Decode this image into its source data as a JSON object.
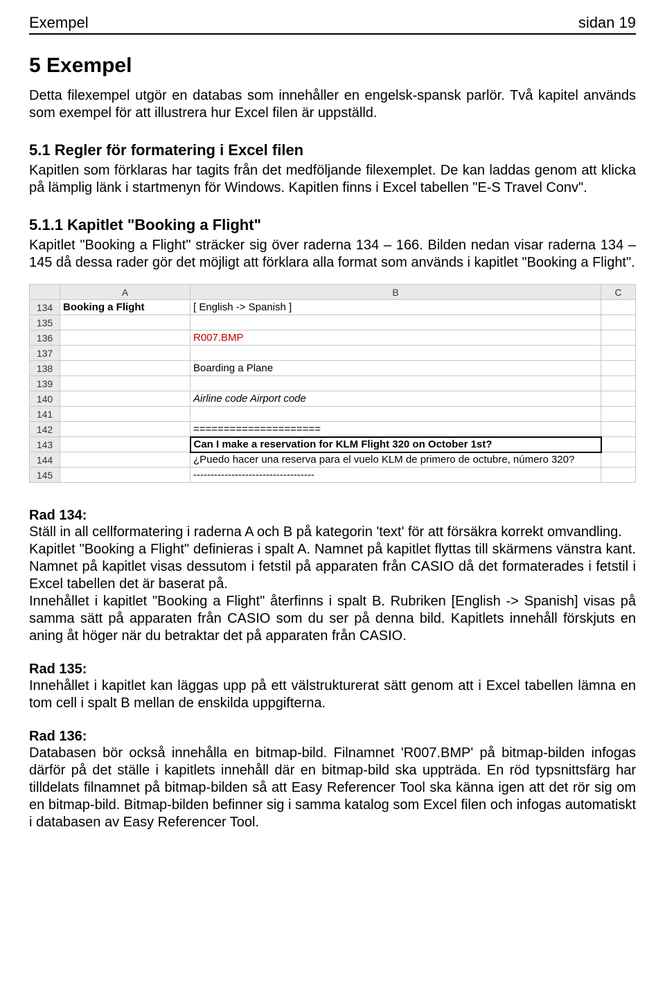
{
  "header": {
    "left": "Exempel",
    "right": "sidan 19"
  },
  "h1": "5  Exempel",
  "intro": "Detta filexempel utgör en databas som innehåller en engelsk-spansk parlör. Två kapitel används som exempel för att illustrera hur Excel filen är uppställd.",
  "h2": "5.1  Regler för formatering i Excel filen",
  "p2": "Kapitlen som förklaras har tagits från det medföljande filexemplet. De kan laddas genom att klicka på lämplig länk i startmenyn för Windows. Kapitlen finns i Excel tabellen \"E-S Travel Conv\".",
  "h3": "5.1.1 Kapitlet \"Booking a Flight\"",
  "p3": "Kapitlet \"Booking a Flight\" sträcker sig över raderna 134 – 166. Bilden nedan visar raderna 134 – 145 då dessa rader gör det möjligt att förklara alla format som används i kapitlet \"Booking a Flight\".",
  "excel": {
    "cols": [
      "",
      "A",
      "B",
      "C"
    ],
    "rows": [
      {
        "num": "134",
        "a": "Booking a Flight",
        "b": "[ English -> Spanish ]",
        "aBold": true
      },
      {
        "num": "135",
        "a": "",
        "b": ""
      },
      {
        "num": "136",
        "a": "",
        "b": "R007.BMP",
        "bRed": true
      },
      {
        "num": "137",
        "a": "",
        "b": ""
      },
      {
        "num": "138",
        "a": "",
        "b": "Boarding a Plane"
      },
      {
        "num": "139",
        "a": "",
        "b": ""
      },
      {
        "num": "140",
        "a": "",
        "b": "Airline code    Airport code",
        "bItalic": true
      },
      {
        "num": "141",
        "a": "",
        "b": ""
      },
      {
        "num": "142",
        "a": "",
        "b": "=====================",
        "dashes": true
      },
      {
        "num": "143",
        "a": "",
        "b": "Can I make a reservation for KLM Flight 320 on October 1st?",
        "boxed": true
      },
      {
        "num": "144",
        "a": "",
        "b": "¿Puedo hacer una reserva para el vuelo KLM de primero de octubre, número 320?"
      },
      {
        "num": "145",
        "a": "",
        "b": "-----------------------------------",
        "dashes": true
      }
    ]
  },
  "rad134_label": "Rad 134:",
  "rad134_p1": "Ställ in all cellformatering i raderna A och B på kategorin 'text' för att försäkra korrekt omvandling.",
  "rad134_p2": "Kapitlet \"Booking a Flight\" definieras i spalt A. Namnet på kapitlet flyttas till skärmens vänstra kant. Namnet på kapitlet visas dessutom i fetstil på apparaten från CASIO då det formaterades i fetstil i Excel tabellen det är baserat på.",
  "rad134_p3": "Innehållet i kapitlet \"Booking a Flight\" återfinns i spalt B. Rubriken [English -> Spanish] visas på samma sätt på apparaten från CASIO som du ser på denna bild. Kapitlets innehåll förskjuts en aning åt höger när du betraktar det på apparaten från CASIO.",
  "rad135_label": "Rad 135:",
  "rad135_p1": "Innehållet i kapitlet kan läggas upp på ett välstrukturerat sätt genom att i Excel tabellen lämna en tom cell i spalt B mellan de enskilda uppgifterna.",
  "rad136_label": "Rad 136:",
  "rad136_p1": "Databasen bör också innehålla en bitmap-bild. Filnamnet 'R007.BMP' på bitmap-bilden infogas därför på det ställe i kapitlets innehåll där en bitmap-bild ska uppträda. En röd typsnittsfärg har tilldelats filnamnet på bitmap-bilden så att Easy Referencer Tool ska känna igen att det rör sig om en bitmap-bild. Bitmap-bilden befinner sig i samma katalog som Excel filen och infogas automatiskt i databasen av Easy Referencer Tool."
}
